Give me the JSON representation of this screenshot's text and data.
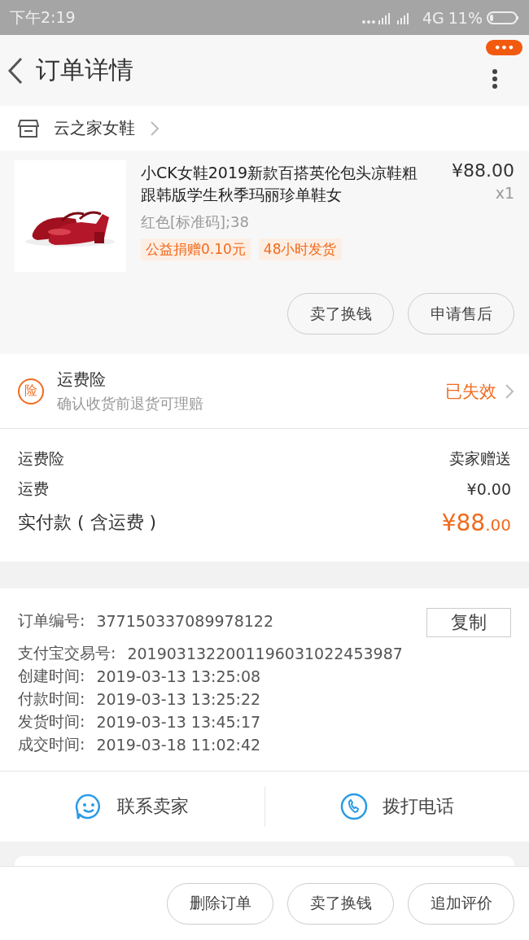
{
  "status_bar": {
    "time": "下午2:19",
    "network": "4G",
    "battery": "11%"
  },
  "header": {
    "title": "订单详情",
    "menu_badge": "•••"
  },
  "shop": {
    "name": "云之家女鞋"
  },
  "product": {
    "kind": "picture",
    "title": "小CK女鞋2019新款百搭英伦包头凉鞋粗跟韩版学生秋季玛丽珍单鞋女",
    "variant": "红色[标准码];38",
    "tags": [
      "公益捐赠0.10元",
      "48小时发货"
    ],
    "price": "¥88.00",
    "quantity": "x1",
    "actions": [
      "卖了换钱",
      "申请售后"
    ]
  },
  "insurance": {
    "badge": "险",
    "title": "运费险",
    "subtitle": "确认收货前退货可理赔",
    "status": "已失效"
  },
  "fees": [
    {
      "label": "运费险",
      "value": "卖家赠送"
    },
    {
      "label": "运费",
      "value": "¥0.00"
    }
  ],
  "total": {
    "label": "实付款 ( 含运费 )",
    "amount_main": "¥88",
    "amount_cents": ".00"
  },
  "order_info": {
    "copy_button": "复制",
    "rows": [
      {
        "label": "订单编号:",
        "value": "377150337089978122"
      },
      {
        "label": "支付宝交易号:",
        "value": "2019031322001196031022453987"
      },
      {
        "label": "创建时间:",
        "value": "2019-03-13 13:25:08"
      },
      {
        "label": "付款时间:",
        "value": "2019-03-13 13:25:22"
      },
      {
        "label": "发货时间:",
        "value": "2019-03-13 13:45:17"
      },
      {
        "label": "成交时间:",
        "value": "2019-03-18 11:02:42"
      }
    ]
  },
  "contact": [
    {
      "kind": "chat",
      "label": "联系卖家"
    },
    {
      "kind": "phone",
      "label": "拨打电话"
    }
  ],
  "bottom_actions": [
    "删除订单",
    "卖了换钱",
    "追加评价"
  ]
}
